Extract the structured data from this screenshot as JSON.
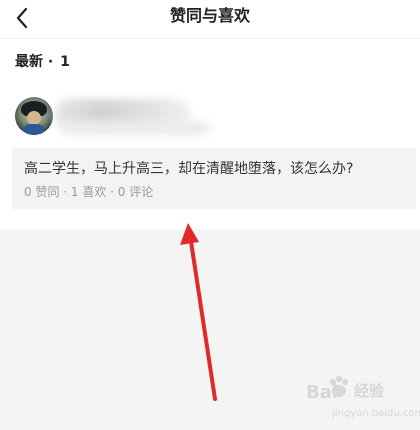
{
  "header": {
    "title": "赞同与喜欢",
    "back_icon": "chevron-left-icon"
  },
  "section": {
    "label": "最新",
    "separator": "·",
    "count": "1"
  },
  "post": {
    "text": "高二学生，马上升高三，却在清醒地堕落，该怎么办?",
    "stats": "0 赞同 · 1 喜欢 · 0 评论"
  },
  "annotation": {
    "arrow_color": "#e02a2a"
  },
  "watermark": {
    "brand_left": "Bai",
    "brand_right": "经验",
    "url": "jingyan.baidu.com"
  }
}
